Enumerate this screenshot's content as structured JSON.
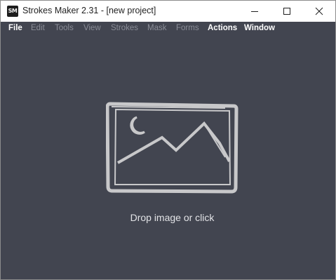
{
  "window": {
    "title": "Strokes Maker 2.31 - [new project]",
    "app_icon_text": "SM"
  },
  "menu": [
    {
      "label": "File",
      "enabled": true
    },
    {
      "label": "Edit",
      "enabled": false
    },
    {
      "label": "Tools",
      "enabled": false
    },
    {
      "label": "View",
      "enabled": false
    },
    {
      "label": "Strokes",
      "enabled": false
    },
    {
      "label": "Mask",
      "enabled": false
    },
    {
      "label": "Forms",
      "enabled": false
    },
    {
      "label": "Actions",
      "enabled": true
    },
    {
      "label": "Window",
      "enabled": true
    }
  ],
  "drop": {
    "label": "Drop image or click",
    "icon": "image-placeholder-icon"
  },
  "colors": {
    "background": "#424550",
    "titlebar": "#ffffff",
    "menu_enabled": "#ffffff",
    "menu_disabled": "#8a8d97",
    "icon_stroke": "#c8c8ca"
  }
}
